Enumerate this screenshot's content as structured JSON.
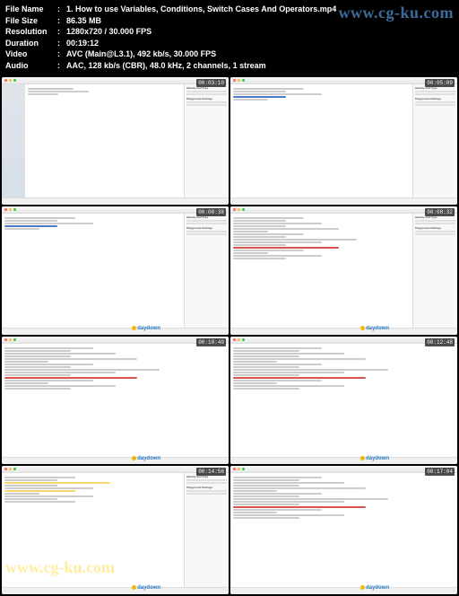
{
  "header": {
    "filename_label": "File Name",
    "filename": "1. How to use Variables, Conditions, Switch Cases And Operators.mp4",
    "filesize_label": "File Size",
    "filesize": "86.35 MB",
    "resolution_label": "Resolution",
    "resolution": "1280x720 / 30.000 FPS",
    "duration_label": "Duration",
    "duration": "00:19:12",
    "video_label": "Video",
    "video": "AVC (Main@L3.1), 492 kb/s, 30.000 FPS",
    "audio_label": "Audio",
    "audio": "AAC, 128 kb/s (CBR), 48.0 kHz, 2 channels, 1 stream"
  },
  "watermarks": {
    "top": "www.cg-ku.com",
    "bottom": "www.cg-ku.com",
    "thumb": "daydown"
  },
  "thumbs": [
    {
      "timestamp": "00:03:10",
      "has_sidebar": true,
      "has_inspector": true,
      "layout": "split"
    },
    {
      "timestamp": "00:05:09",
      "has_sidebar": false,
      "has_inspector": true,
      "layout": "code"
    },
    {
      "timestamp": "00:08:38",
      "has_sidebar": false,
      "has_inspector": true,
      "layout": "code"
    },
    {
      "timestamp": "00:08:32",
      "has_sidebar": false,
      "has_inspector": true,
      "layout": "code-long"
    },
    {
      "timestamp": "00:10:40",
      "has_sidebar": false,
      "has_inspector": false,
      "layout": "code-long"
    },
    {
      "timestamp": "00:12:48",
      "has_sidebar": false,
      "has_inspector": false,
      "layout": "code-long"
    },
    {
      "timestamp": "00:14:56",
      "has_sidebar": false,
      "has_inspector": true,
      "layout": "code-yellow"
    },
    {
      "timestamp": "00:17:04",
      "has_sidebar": false,
      "has_inspector": false,
      "layout": "code-long"
    }
  ]
}
